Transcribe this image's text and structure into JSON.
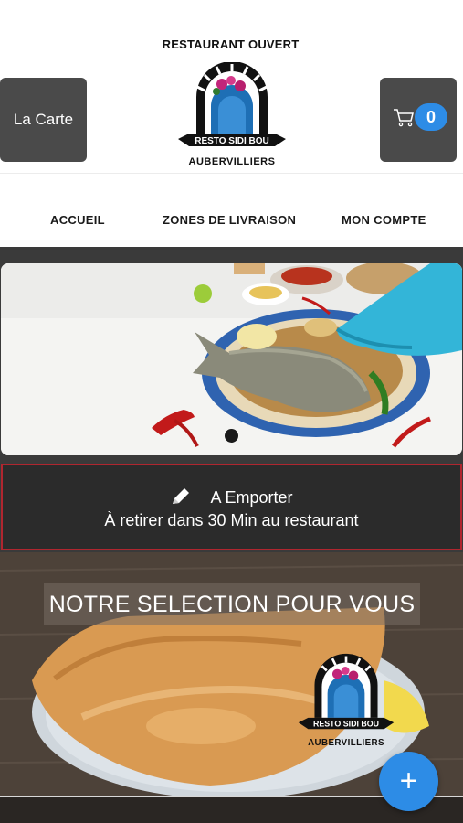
{
  "status": {
    "text": "RESTAURANT OUVERT"
  },
  "header": {
    "carte_label": "La Carte",
    "cart_count": "0",
    "logo": {
      "name": "RESTO SIDI BOU",
      "city": "AUBERVILLIERS"
    }
  },
  "nav": {
    "items": [
      {
        "label": "ACCUEIL"
      },
      {
        "label": "ZONES DE LIVRAISON"
      },
      {
        "label": "MON COMPTE"
      }
    ]
  },
  "banner": {
    "slide_count": 1,
    "active_slide": 1
  },
  "emporter": {
    "title": "A Emporter",
    "subtitle": "À retirer dans 30 Min au restaurant",
    "icon": "pencil-icon"
  },
  "selection": {
    "title": "NOTRE SELECTION POUR VOUS",
    "logo": {
      "name": "RESTO SIDI BOU",
      "city": "AUBERVILLIERS"
    }
  },
  "fab": {
    "label": "+"
  },
  "colors": {
    "accent": "#2d8ce6",
    "button_bg": "#4a4a4a",
    "emporter_border": "#b0262f",
    "dark_bg": "#3a3a3a"
  }
}
